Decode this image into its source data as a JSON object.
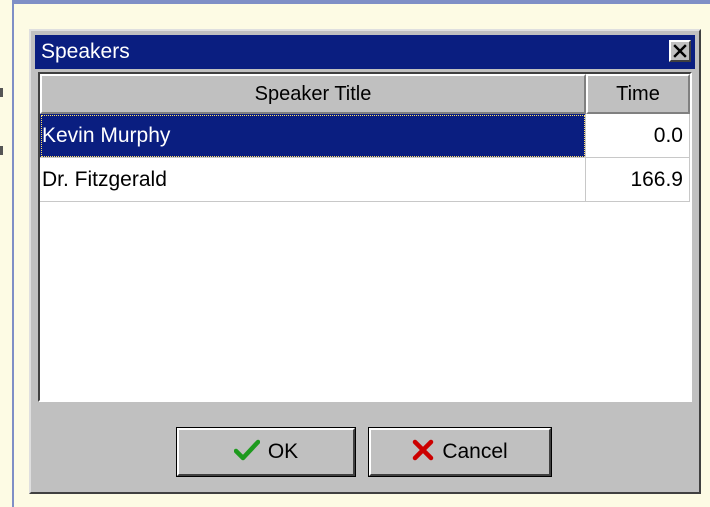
{
  "dialog": {
    "title": "Speakers"
  },
  "grid": {
    "columns": [
      "Speaker Title",
      "Time"
    ],
    "rows": [
      [
        "Kevin Murphy",
        "0.0"
      ],
      [
        "Dr. Fitzgerald",
        "166.9"
      ]
    ],
    "selected_row": 0
  },
  "buttons": {
    "ok_label": "OK",
    "cancel_label": "Cancel"
  },
  "colors": {
    "titlebar": "#0a1e80",
    "selection": "#0a1e80",
    "dialog_face": "#c0c0c0",
    "ok_check": "#1e9a1e",
    "cancel_x": "#cc0000"
  },
  "icons": {
    "close": "close-icon",
    "ok": "checkmark-icon",
    "cancel": "x-mark-icon"
  }
}
